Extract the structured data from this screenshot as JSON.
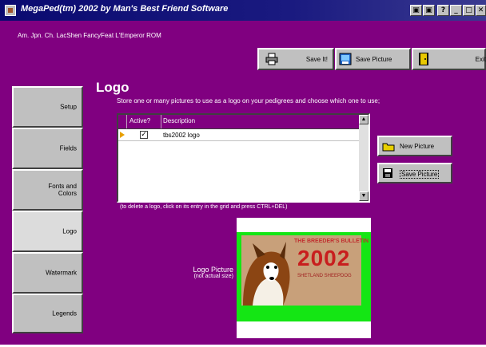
{
  "window": {
    "title": "MegaPed(tm) 2002 by Man's Best Friend Software",
    "owner": "Am. Jpn. Ch. LacShen FancyFeat L'Emperor ROM",
    "title_buttons": [
      "▣",
      "▣",
      "?",
      "_",
      "□",
      "✕"
    ]
  },
  "toolbar": {
    "save_label": "Save It!",
    "save_picture_label": "Save Picture",
    "exit_label": "Exit"
  },
  "sidebar": {
    "items": [
      {
        "label": "Setup"
      },
      {
        "label": "Fields"
      },
      {
        "label": "Fonts and\nColors"
      },
      {
        "label": "Logo"
      },
      {
        "label": "Watermark"
      },
      {
        "label": "Legends"
      }
    ]
  },
  "main": {
    "heading": "Logo",
    "instruction": "Store one or many pictures to use as a logo on your pedigrees and choose which one to use;",
    "grid": {
      "columns": [
        "Active?",
        "Description"
      ],
      "rows": [
        {
          "active": true,
          "description": "tbs2002 logo"
        }
      ]
    },
    "hint": "(to delete a logo, click on its entry in the grid and press CTRL+DEL)",
    "new_picture_label": "New Picture",
    "save_picture_label": "Save Picture",
    "logo_picture_label": "Logo Picture",
    "logo_picture_note": "(not actual size)",
    "logo_image": {
      "header_text": "THE BREEDER'S BULLETIN",
      "year": "2002",
      "subtitle": "SHETLAND SHEEPDOG"
    }
  },
  "colors": {
    "background": "#800080",
    "grid_header": "#800080",
    "picture_backdrop": "#14e614"
  }
}
